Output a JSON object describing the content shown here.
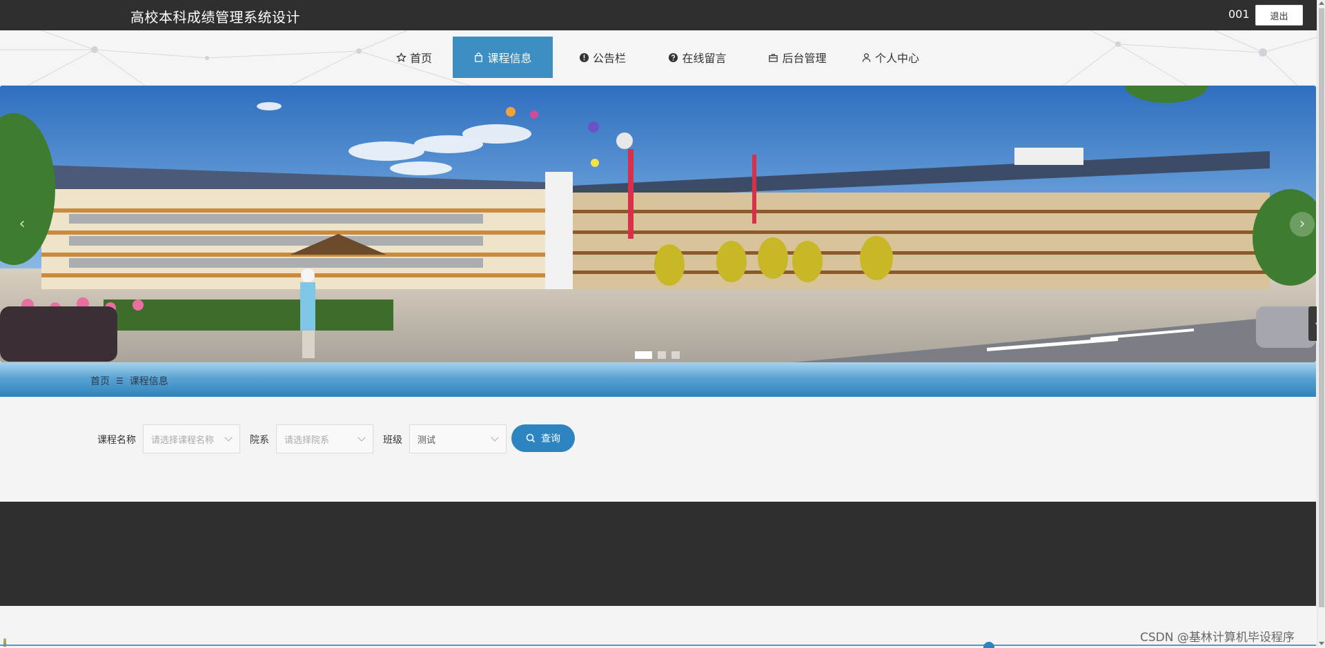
{
  "header": {
    "title": "高校本科成绩管理系统设计",
    "username": "001",
    "logout_label": "退出"
  },
  "nav": {
    "items": [
      {
        "label": "首页",
        "icon": "star-icon",
        "active": false
      },
      {
        "label": "课程信息",
        "icon": "bag-icon",
        "active": true
      },
      {
        "label": "公告栏",
        "icon": "exclamation-circle-icon",
        "active": false
      },
      {
        "label": "在线留言",
        "icon": "question-circle-icon",
        "active": false
      },
      {
        "label": "后台管理",
        "icon": "briefcase-icon",
        "active": false
      },
      {
        "label": "个人中心",
        "icon": "user-icon",
        "active": false
      }
    ]
  },
  "banner": {
    "image_description": "school campus buildings with kites",
    "slide_count": 3,
    "active_slide": 1
  },
  "breadcrumb": {
    "home": "首页",
    "separator": "☰",
    "current": "课程信息"
  },
  "search": {
    "course_label": "课程名称",
    "course_placeholder": "请选择课程名称",
    "dept_label": "院系",
    "dept_placeholder": "请选择院系",
    "class_label": "班级",
    "class_value": "测试",
    "button_label": "查询"
  },
  "watermark": "CSDN @基林计算机毕设程序",
  "colors": {
    "topbar": "#2f2f2f",
    "accent": "#3b8fc2",
    "button": "#2c85c0",
    "footer": "#2f2f2f"
  }
}
